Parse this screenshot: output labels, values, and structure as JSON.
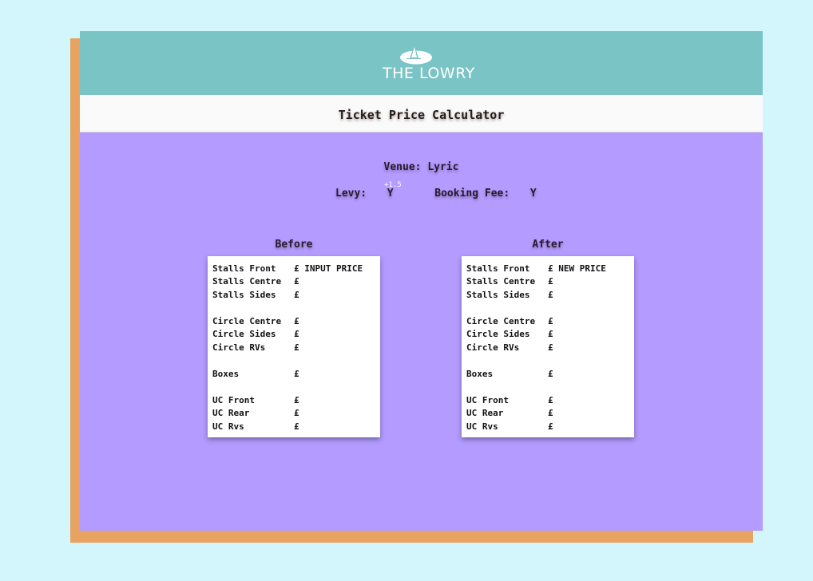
{
  "brand": {
    "logo_text": "THE LOWRY"
  },
  "title": "Ticket Price Calculator",
  "venue": {
    "label": "Venue:",
    "value": "Lyric"
  },
  "levy": {
    "label": "Levy:",
    "value": "Y",
    "extra": "+1.5"
  },
  "booking_fee": {
    "label": "Booking Fee:",
    "value": "Y"
  },
  "before": {
    "title": "Before",
    "rows": [
      {
        "label": "Stalls Front",
        "value": "£ INPUT PRICE"
      },
      {
        "label": "Stalls Centre",
        "value": "£"
      },
      {
        "label": "Stalls Sides",
        "value": "£"
      },
      {
        "label": "Circle Centre",
        "value": "£"
      },
      {
        "label": "Circle Sides",
        "value": "£"
      },
      {
        "label": "Circle RVs",
        "value": "£"
      },
      {
        "label": "Boxes",
        "value": "£"
      },
      {
        "label": "UC Front",
        "value": "£"
      },
      {
        "label": "UC Rear",
        "value": "£"
      },
      {
        "label": "UC Rvs",
        "value": "£"
      }
    ]
  },
  "after": {
    "title": "After",
    "rows": [
      {
        "label": "Stalls Front",
        "value": "£ NEW PRICE"
      },
      {
        "label": "Stalls Centre",
        "value": "£"
      },
      {
        "label": "Stalls Sides",
        "value": "£"
      },
      {
        "label": "Circle Centre",
        "value": "£"
      },
      {
        "label": "Circle Sides",
        "value": "£"
      },
      {
        "label": "Circle RVs",
        "value": "£"
      },
      {
        "label": "Boxes",
        "value": "£"
      },
      {
        "label": "UC Front",
        "value": "£"
      },
      {
        "label": "UC Rear",
        "value": "£"
      },
      {
        "label": "UC Rvs",
        "value": "£"
      }
    ]
  },
  "colors": {
    "page_bg": "#d3f6fc",
    "header_bg": "#7bc4c6",
    "card_bg": "#b39bff",
    "card_shadow": "#e8a262"
  }
}
